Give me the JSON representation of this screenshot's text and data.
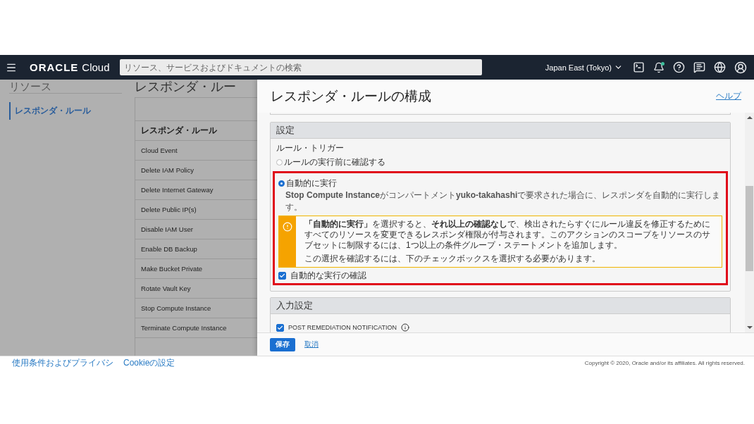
{
  "navbar": {
    "logo_word": "ORACLE",
    "logo_suffix": "Cloud",
    "search": {
      "placeholder": "リソース、サービスおよびドキュメントの検索"
    },
    "region": "Japan East (Tokyo)",
    "notification_dot": true
  },
  "sidebar": {
    "heading": "リソース",
    "items": [
      {
        "label": "レスポンダ・ルール",
        "selected": true
      }
    ]
  },
  "page_title": "レスポンダ・ルー",
  "table": {
    "column": "レスポンダ・ルール",
    "rows": [
      "Cloud Event",
      "Delete IAM Policy",
      "Delete Internet Gateway",
      "Delete Public IP(s)",
      "Disable IAM User",
      "Enable DB Backup",
      "Make Bucket Private",
      "Rotate Vault Key",
      "Stop Compute Instance",
      "Terminate Compute Instance"
    ]
  },
  "panel": {
    "title": "レスポンダ・ルールの構成",
    "help": "ヘルプ",
    "settings": {
      "title": "設定",
      "trigger_label": "ルール・トリガー",
      "options": [
        {
          "label": "ルールの実行前に確認する",
          "selected": false
        },
        {
          "label": "自動的に実行",
          "selected": true,
          "description": "**Stop Compute Instance**がコンパートメント**yuko-takahashi**で要求された場合に、レスポンダを自動的に実行します。"
        }
      ],
      "warning": [
        "**「自動的に実行」**を選択すると、**それ以上の確認なし**で、検出されたらすぐにルール違反を修正するためにすべてのリソースを変更できるレスポンダ権限が付与されます。このアクションのスコープをリソースのサブセットに制限するには、1つ以上の条件グループ・ステートメントを追加します。",
        "この選択を確認するには、下のチェックボックスを選択する必要があります。"
      ],
      "confirm": {
        "label": "自動的な実行の確認",
        "checked": true
      }
    },
    "input_settings": {
      "title": "入力設定",
      "checkbox": {
        "label": "POST REMEDIATION NOTIFICATION",
        "checked": true
      }
    },
    "save": "保存",
    "cancel": "取消"
  },
  "footer": {
    "links": [
      "使用条件およびプライバシ",
      "Cookieの設定"
    ],
    "copyright": "Copyright © 2020, Oracle and/or its affiliates. All rights reserved."
  }
}
